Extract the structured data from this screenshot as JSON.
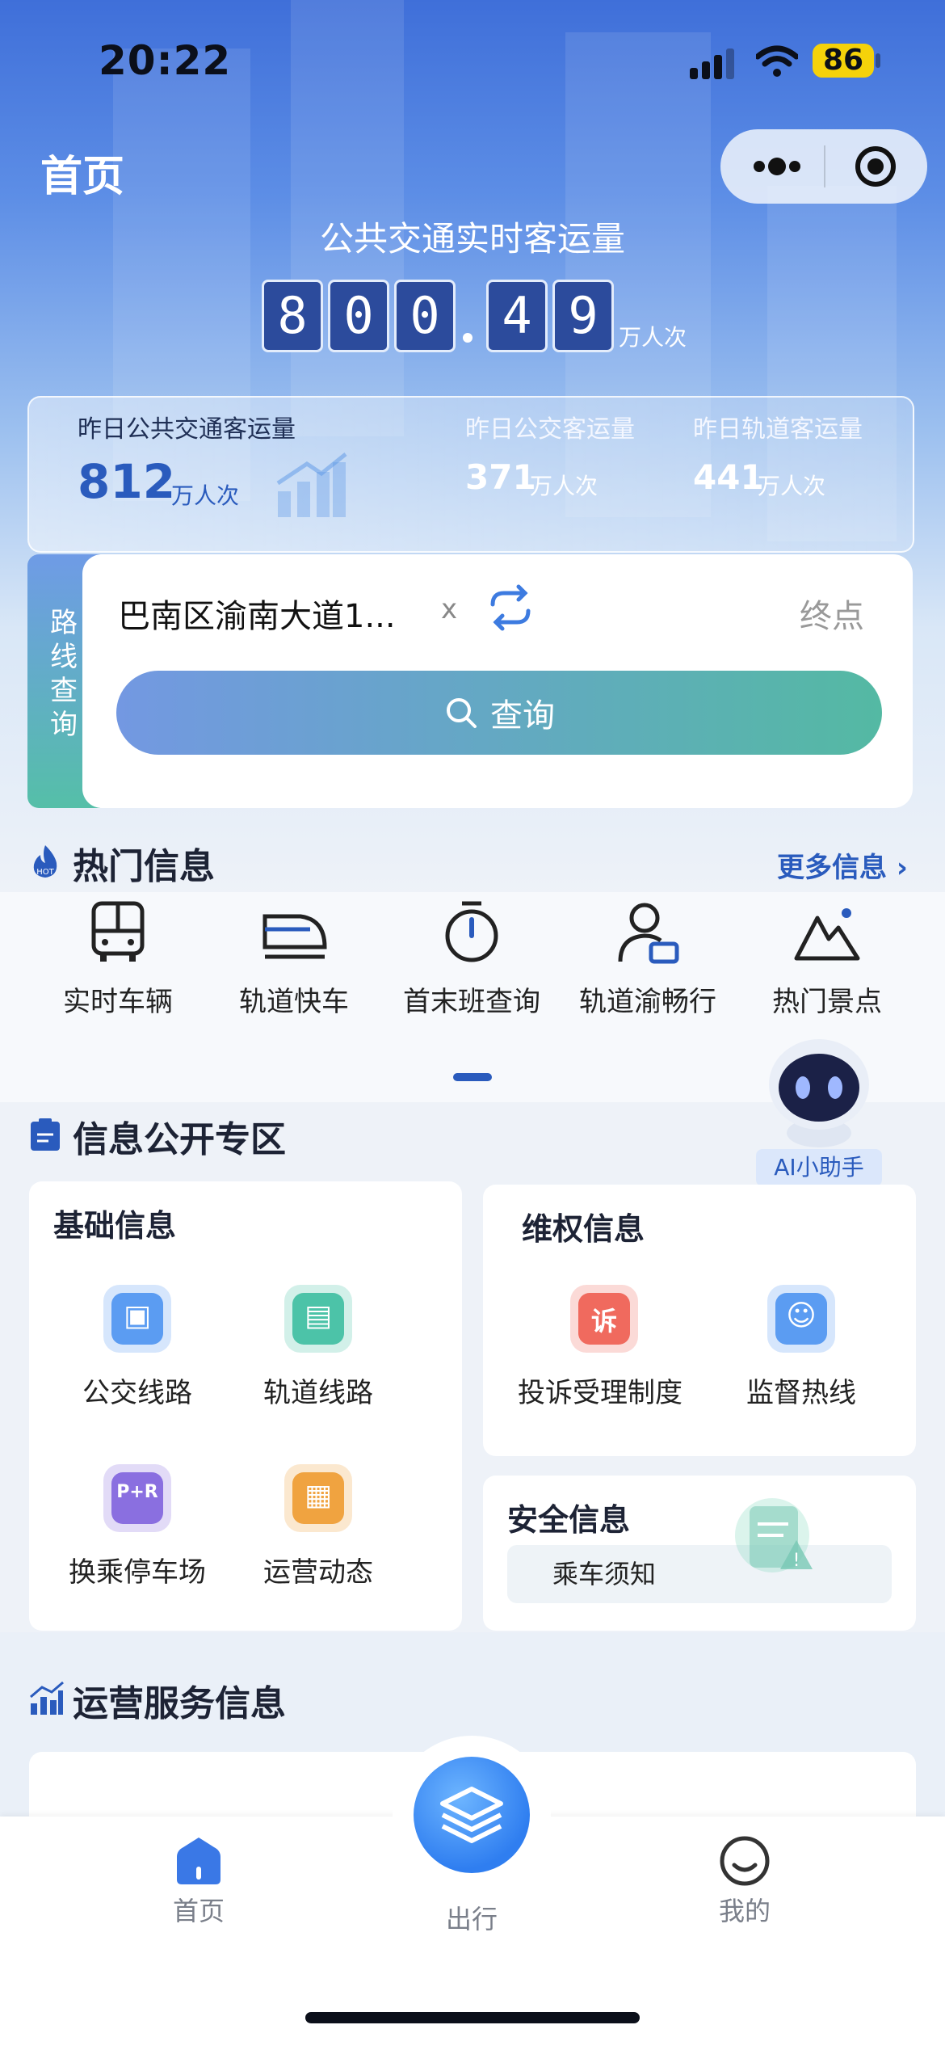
{
  "status_bar": {
    "time": "20:22",
    "battery": "86"
  },
  "header": {
    "title": "首页"
  },
  "realtime": {
    "label": "公共交通实时客运量",
    "digits": [
      "8",
      "0",
      "0",
      "4",
      "9"
    ],
    "unit": "万人次"
  },
  "yesterday": {
    "total": {
      "label": "昨日公共交通客运量",
      "value": "812",
      "unit": "万人次"
    },
    "bus": {
      "label": "昨日公交客运量",
      "value": "371",
      "unit": "万人次"
    },
    "rail": {
      "label": "昨日轨道客运量",
      "value": "441",
      "unit": "万人次"
    }
  },
  "route_query": {
    "side_label": [
      "路",
      "线",
      "查",
      "询"
    ],
    "from": "巴南区渝南大道1...",
    "clear": "x",
    "to_placeholder": "终点",
    "search_label": "查询"
  },
  "hot_info": {
    "title": "热门信息",
    "more": "更多信息",
    "items": [
      {
        "label": "实时车辆",
        "icon": "bus-icon"
      },
      {
        "label": "轨道快车",
        "icon": "train-icon"
      },
      {
        "label": "首末班查询",
        "icon": "stopwatch-icon"
      },
      {
        "label": "轨道渝畅行",
        "icon": "person-card-icon"
      },
      {
        "label": "热门景点",
        "icon": "mountain-icon"
      }
    ]
  },
  "assistant": {
    "label": "AI小助手"
  },
  "public_info": {
    "title": "信息公开专区",
    "basic": {
      "title": "基础信息",
      "items": [
        {
          "label": "公交线路",
          "icon": "bus-line-icon",
          "color": "#5b9cf2"
        },
        {
          "label": "轨道线路",
          "icon": "rail-line-icon",
          "color": "#4cc3a8"
        },
        {
          "label": "换乘停车场",
          "icon": "park-ride-icon",
          "color": "#8a6fe0"
        },
        {
          "label": "运营动态",
          "icon": "news-icon",
          "color": "#f0a340"
        }
      ]
    },
    "rights": {
      "title": "维权信息",
      "items": [
        {
          "label": "投诉受理制度",
          "icon": "complaint-icon",
          "color": "#f06a5e",
          "badge": "诉"
        },
        {
          "label": "监督热线",
          "icon": "hotline-icon",
          "color": "#5b9cf2"
        }
      ]
    },
    "safety": {
      "title": "安全信息",
      "notice": "乘车须知"
    }
  },
  "operation": {
    "title": "运营服务信息"
  },
  "tabbar": {
    "home": "首页",
    "travel": "出行",
    "mine": "我的"
  }
}
